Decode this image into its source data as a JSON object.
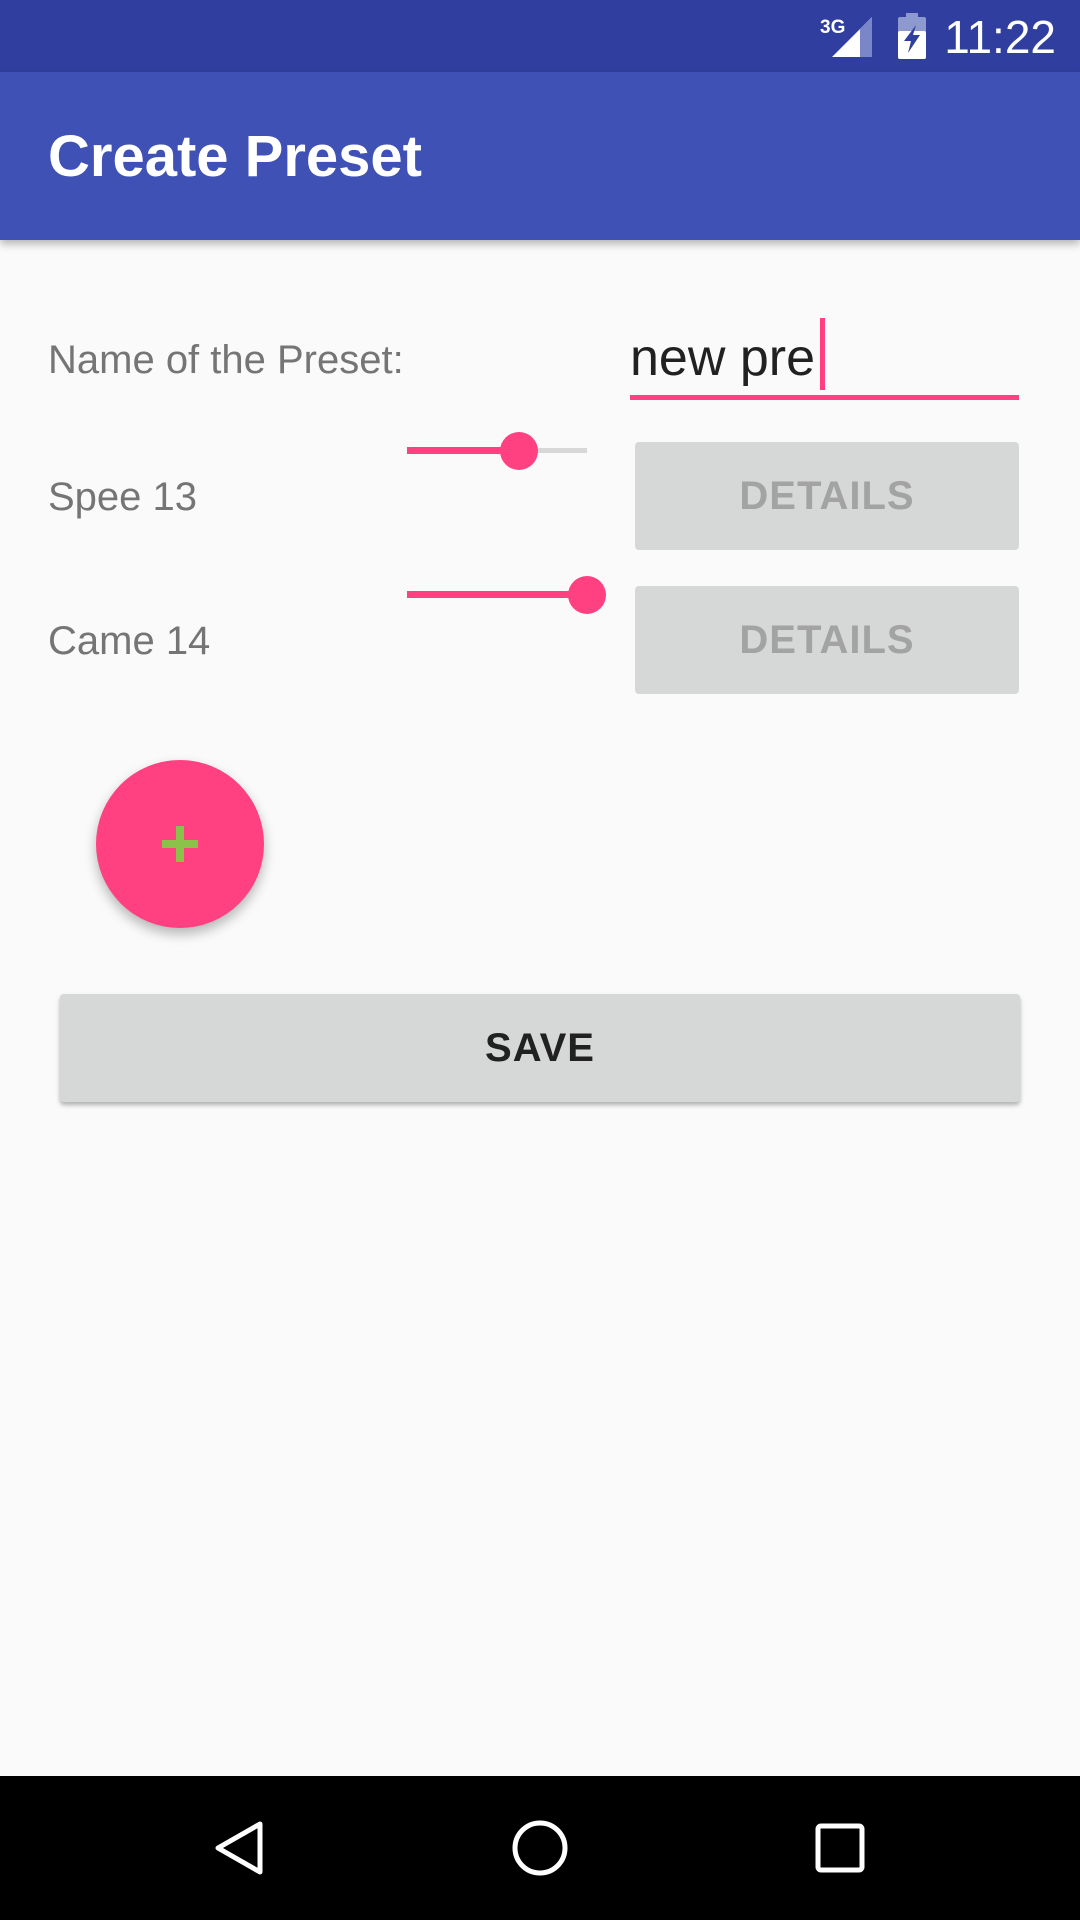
{
  "status_bar": {
    "network": "3G",
    "time": "11:22"
  },
  "app_bar": {
    "title": "Create Preset"
  },
  "form": {
    "name_label": "Name of the Preset:",
    "name_value": "new pre"
  },
  "rows": [
    {
      "label": "Spee 13",
      "slider_fraction": 0.62,
      "details_label": "DETAILS"
    },
    {
      "label": "Came 14",
      "slider_fraction": 1.0,
      "details_label": "DETAILS"
    }
  ],
  "fab": {
    "icon": "plus-icon"
  },
  "save_label": "SAVE",
  "nav_bar": {
    "icons": [
      "back-icon",
      "home-icon",
      "recents-icon"
    ]
  },
  "colors": {
    "status_bar": "#303f9f",
    "app_bar": "#3f51b5",
    "accent": "#ff4081",
    "plus": "#8bc34a",
    "button_bg": "#d6d7d7",
    "disabled_text": "#a3a3a3"
  }
}
